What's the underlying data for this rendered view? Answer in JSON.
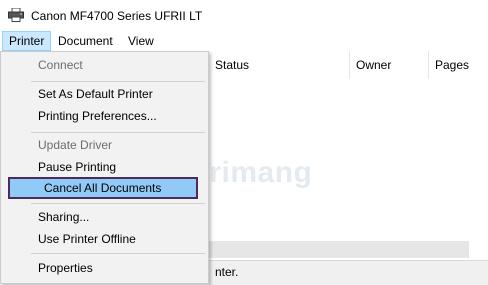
{
  "window": {
    "title": "Canon MF4700 Series UFRII LT",
    "icon": "printer-icon"
  },
  "menubar": {
    "items": [
      "Printer",
      "Document",
      "View"
    ],
    "active": "Printer"
  },
  "columns": [
    "Status",
    "Owner",
    "Pages"
  ],
  "status_bar": {
    "text": "nter."
  },
  "watermark": {
    "text": "uantrimang"
  },
  "printer_menu": {
    "connect": "Connect",
    "set_default": "Set As Default Printer",
    "preferences": "Printing Preferences...",
    "update_driver": "Update Driver",
    "pause": "Pause Printing",
    "cancel_all": "Cancel All Documents",
    "sharing": "Sharing...",
    "offline": "Use Printer Offline",
    "properties": "Properties"
  },
  "colors": {
    "highlight": "#91c9f7",
    "highlight_border": "#4b2b5e",
    "menu_bg": "#f2f2f2",
    "disabled_text": "#6d6d6d"
  }
}
